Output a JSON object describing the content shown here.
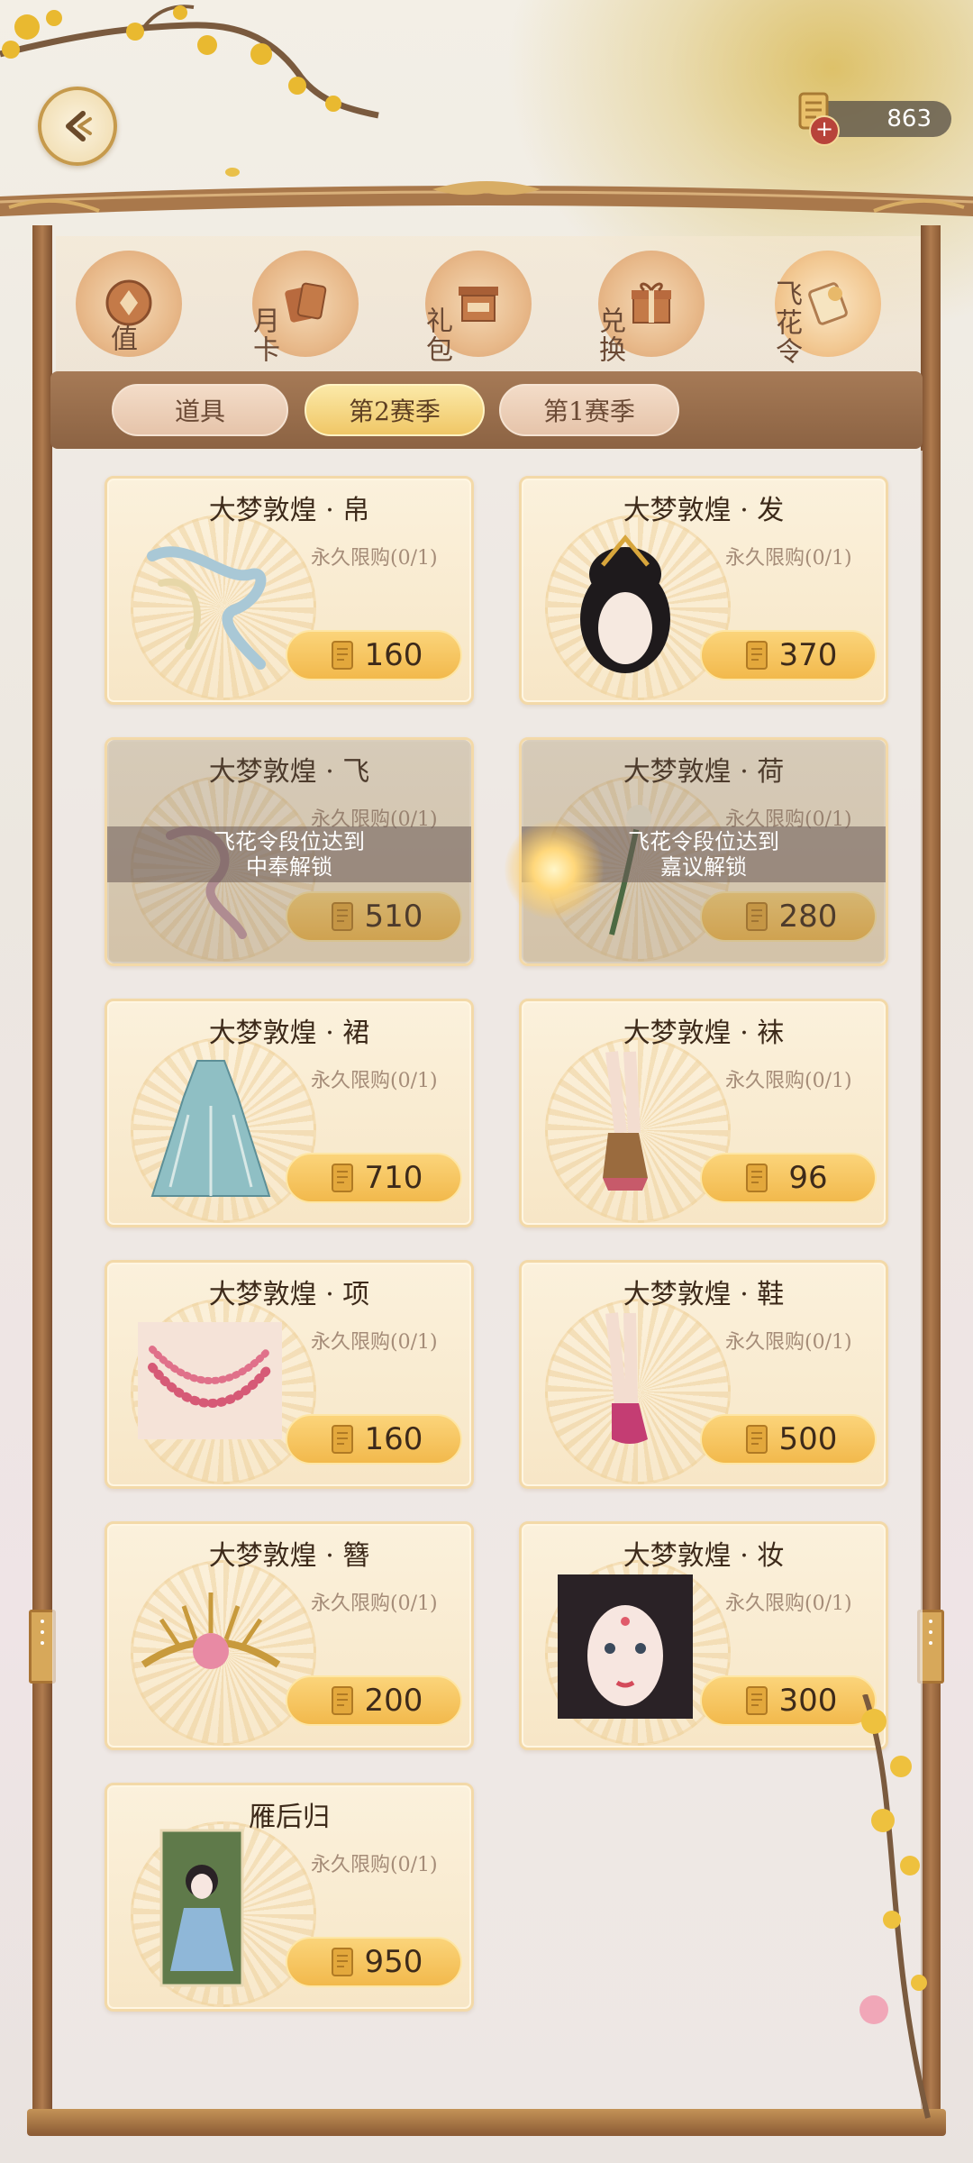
{
  "header": {
    "back_icon": "back-arrow-icon",
    "currency_icon": "scroll-ticket-icon",
    "currency_add_label": "+",
    "currency_amount": "863"
  },
  "nav": [
    {
      "label": "值",
      "icon": "coin-icon"
    },
    {
      "label": "月卡",
      "icon": "cards-icon"
    },
    {
      "label": "礼包",
      "icon": "gift-box-icon"
    },
    {
      "label": "兑换",
      "icon": "present-icon"
    },
    {
      "label": "飞花令",
      "icon": "scroll-icon"
    }
  ],
  "tabs": [
    {
      "label": "道具",
      "active": false
    },
    {
      "label": "第2赛季",
      "active": true
    },
    {
      "label": "第1赛季",
      "active": false
    }
  ],
  "items": [
    {
      "name": "大梦敦煌 · 帛",
      "limit": "永久限购(0/1)",
      "price": "160",
      "art": "ribbon-scarf-art",
      "locked": false,
      "lock_text": [
        "",
        ""
      ]
    },
    {
      "name": "大梦敦煌 · 发",
      "limit": "永久限购(0/1)",
      "price": "370",
      "art": "hairstyle-art",
      "locked": false,
      "lock_text": [
        "",
        ""
      ]
    },
    {
      "name": "大梦敦煌 · 飞",
      "limit": "永久限购(0/1)",
      "price": "510",
      "art": "flying-ribbon-art",
      "locked": true,
      "lock_text": [
        "飞花令段位达到",
        "中奉解锁"
      ]
    },
    {
      "name": "大梦敦煌 · 荷",
      "limit": "永久限购(0/1)",
      "price": "280",
      "art": "lotus-art",
      "locked": true,
      "lock_text": [
        "飞花令段位达到",
        "嘉议解锁"
      ]
    },
    {
      "name": "大梦敦煌 · 裙",
      "limit": "永久限购(0/1)",
      "price": "710",
      "art": "dress-art",
      "locked": false,
      "lock_text": [
        "",
        ""
      ]
    },
    {
      "name": "大梦敦煌 · 袜",
      "limit": "永久限购(0/1)",
      "price": "96",
      "art": "socks-art",
      "locked": false,
      "lock_text": [
        "",
        ""
      ]
    },
    {
      "name": "大梦敦煌 · 项",
      "limit": "永久限购(0/1)",
      "price": "160",
      "art": "necklace-art",
      "locked": false,
      "lock_text": [
        "",
        ""
      ]
    },
    {
      "name": "大梦敦煌 · 鞋",
      "limit": "永久限购(0/1)",
      "price": "500",
      "art": "shoes-art",
      "locked": false,
      "lock_text": [
        "",
        ""
      ]
    },
    {
      "name": "大梦敦煌 · 簪",
      "limit": "永久限购(0/1)",
      "price": "200",
      "art": "hairpin-art",
      "locked": false,
      "lock_text": [
        "",
        ""
      ]
    },
    {
      "name": "大梦敦煌 · 妆",
      "limit": "永久限购(0/1)",
      "price": "300",
      "art": "makeup-portrait-art",
      "locked": false,
      "lock_text": [
        "",
        ""
      ]
    },
    {
      "name": "雁后归",
      "limit": "永久限购(0/1)",
      "price": "950",
      "art": "character-card-art",
      "locked": false,
      "lock_text": [
        "",
        ""
      ]
    }
  ],
  "colors": {
    "frame_wood": "#8c6343",
    "tab_active": "#f0c766",
    "price_button": "#f2b94c",
    "card_bg": "#f7e6c6",
    "accent_gold": "#d7a85a"
  }
}
